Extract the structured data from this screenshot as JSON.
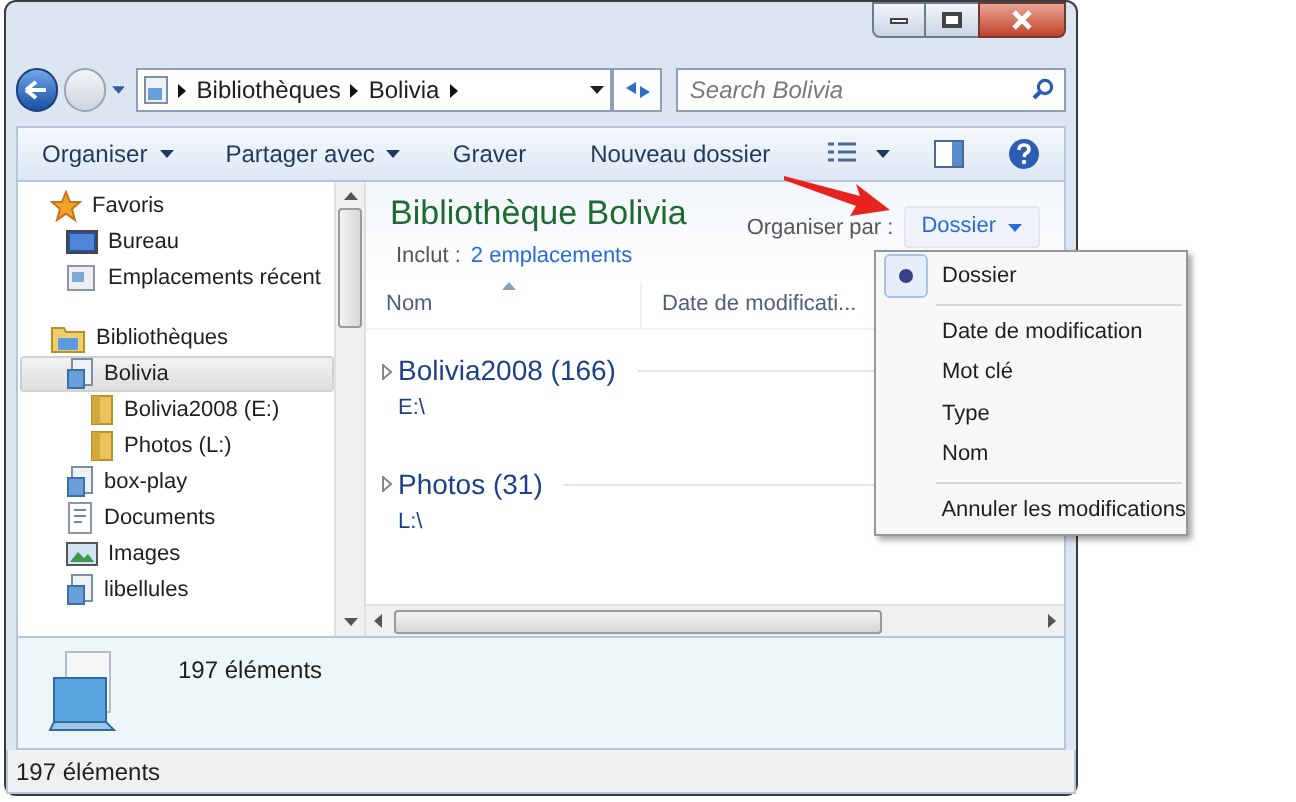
{
  "address_bar": {
    "breadcrumbs": [
      "Bibliothèques",
      "Bolivia"
    ]
  },
  "search": {
    "placeholder": "Search Bolivia"
  },
  "toolbar": {
    "items": [
      {
        "label": "Organiser",
        "dropdown": true
      },
      {
        "label": "Partager avec",
        "dropdown": true
      },
      {
        "label": "Graver",
        "dropdown": false
      },
      {
        "label": "Nouveau dossier",
        "dropdown": false
      }
    ]
  },
  "navigation": {
    "items": [
      {
        "label": "Favoris",
        "kind": "favorites",
        "selected": false,
        "children": [
          {
            "label": "Bureau",
            "kind": "desktop",
            "selected": false
          },
          {
            "label": "Emplacements récent",
            "kind": "recent",
            "selected": false
          }
        ]
      },
      {
        "label": "Bibliothèques",
        "kind": "libraries",
        "selected": false,
        "children": [
          {
            "label": "Bolivia",
            "kind": "library",
            "selected": true,
            "children": [
              {
                "label": "Bolivia2008 (E:)",
                "kind": "folder",
                "selected": false
              },
              {
                "label": "Photos (L:)",
                "kind": "folder",
                "selected": false
              }
            ]
          },
          {
            "label": "box-play",
            "kind": "library",
            "selected": false
          },
          {
            "label": "Documents",
            "kind": "documents",
            "selected": false
          },
          {
            "label": "Images",
            "kind": "pictures",
            "selected": false
          },
          {
            "label": "libellules",
            "kind": "library",
            "selected": false
          }
        ]
      }
    ]
  },
  "content": {
    "title": "Bibliothèque Bolivia",
    "includes_label": "Inclut :",
    "includes_link": "2 emplacements",
    "arrange_label": "Organiser par :",
    "arrange_value": "Dossier",
    "columns": [
      "Nom",
      "Date de modificati..."
    ],
    "groups": [
      {
        "name": "Bolivia2008 (166)",
        "path": "E:\\"
      },
      {
        "name": "Photos (31)",
        "path": "L:\\"
      }
    ]
  },
  "arrange_menu": {
    "sections": [
      {
        "kind": "radio",
        "items": [
          {
            "label": "Dossier",
            "selected": true
          }
        ]
      },
      {
        "kind": "radio",
        "items": [
          {
            "label": "Date de modification",
            "selected": false
          },
          {
            "label": "Mot clé",
            "selected": false
          },
          {
            "label": "Type",
            "selected": false
          },
          {
            "label": "Nom",
            "selected": false
          }
        ]
      },
      {
        "kind": "command",
        "items": [
          {
            "label": "Annuler les modifications"
          }
        ]
      }
    ]
  },
  "details_pane": {
    "count": "197 éléments"
  },
  "status_bar": {
    "text": "197 éléments"
  }
}
